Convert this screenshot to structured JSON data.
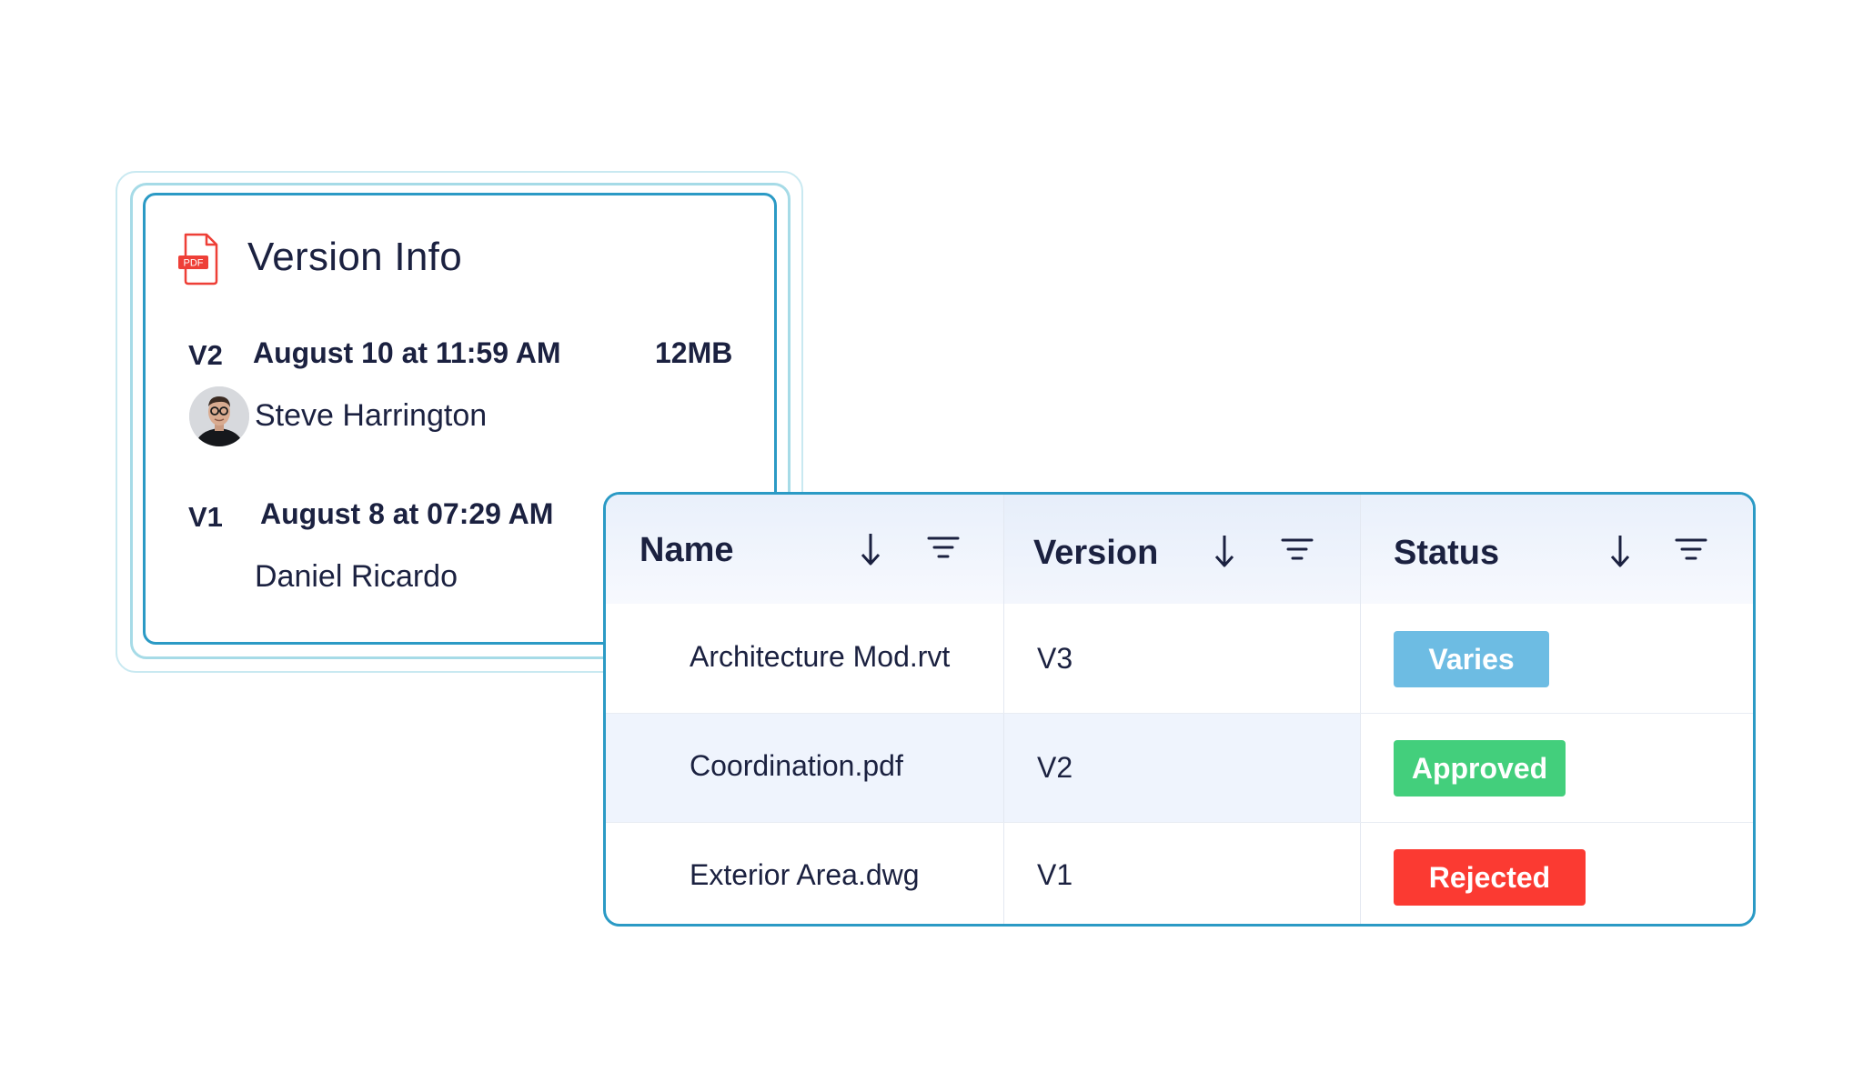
{
  "version_info": {
    "title": "Version Info",
    "file_icon": "pdf-file-icon",
    "file_icon_label": "PDF",
    "versions": [
      {
        "tag": "V2",
        "date": "August 10 at 11:59 AM",
        "size": "12MB",
        "author": "Steve Harrington",
        "has_avatar": true
      },
      {
        "tag": "V1",
        "date": "August 8 at 07:29 AM",
        "author": "Daniel Ricardo",
        "has_avatar": false
      }
    ]
  },
  "table": {
    "columns": [
      {
        "label": "Name",
        "sort_icon": "arrow-down-icon",
        "filter_icon": "filter-icon"
      },
      {
        "label": "Version",
        "sort_icon": "arrow-down-icon",
        "filter_icon": "filter-icon"
      },
      {
        "label": "Status",
        "sort_icon": "arrow-down-icon",
        "filter_icon": "filter-icon"
      }
    ],
    "rows": [
      {
        "name": "Architecture Mod.rvt",
        "version": "V3",
        "status": "Varies",
        "status_color": "#6dbce3"
      },
      {
        "name": "Coordination.pdf",
        "version": "V2",
        "status": "Approved",
        "status_color": "#43cf7c"
      },
      {
        "name": "Exterior Area.dwg",
        "version": "V1",
        "status": "Rejected",
        "status_color": "#fb3a32"
      }
    ]
  },
  "colors": {
    "accent_border": "#2b9ac5",
    "text_dark": "#1b2140",
    "pdf_red": "#ee3f37"
  }
}
